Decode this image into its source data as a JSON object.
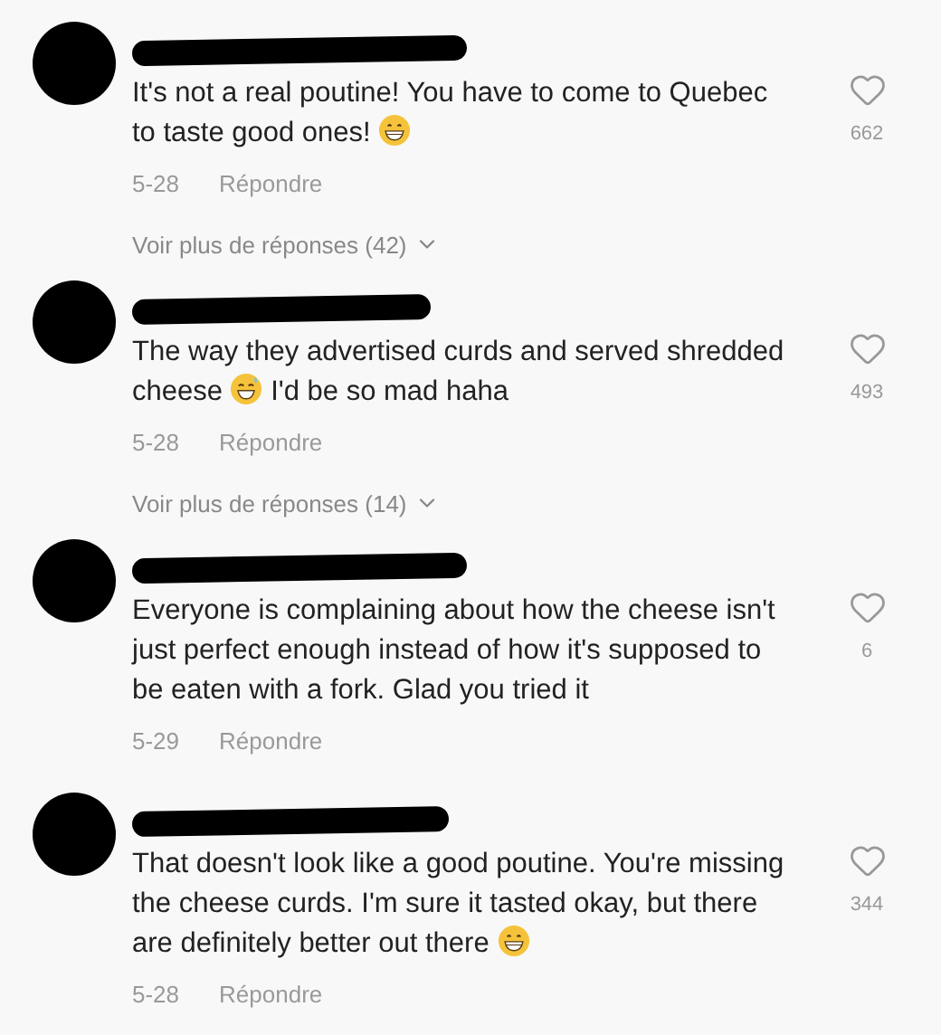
{
  "comments": [
    {
      "body": [
        {
          "kind": "text",
          "text": "It's not a real poutine! You have to come to Quebec to taste good ones! "
        },
        {
          "kind": "grin"
        }
      ],
      "likes": "662",
      "date": "5-28",
      "reply": "Répondre",
      "more_replies": "Voir plus de réponses (42)"
    },
    {
      "body": [
        {
          "kind": "text",
          "text": "The way they advertised curds and served shredded cheese "
        },
        {
          "kind": "sweat"
        },
        {
          "kind": "text",
          "text": " I'd be so mad haha"
        }
      ],
      "likes": "493",
      "date": "5-28",
      "reply": "Répondre",
      "more_replies": "Voir plus de réponses (14)"
    },
    {
      "body": [
        {
          "kind": "text",
          "text": "Everyone is complaining about how the cheese isn't just perfect enough instead of how it's supposed to be eaten with a fork. Glad you tried it"
        }
      ],
      "likes": "6",
      "date": "5-29",
      "reply": "Répondre"
    },
    {
      "body": [
        {
          "kind": "text",
          "text": "That doesn't look like a good poutine. You're missing the cheese curds. I'm sure it tasted okay, but there are definitely better out there "
        },
        {
          "kind": "grin"
        }
      ],
      "likes": "344",
      "date": "5-28",
      "reply": "Répondre"
    }
  ]
}
